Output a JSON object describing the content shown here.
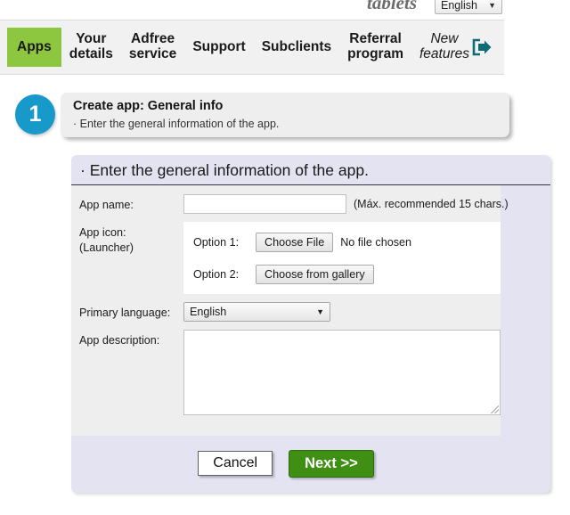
{
  "top": {
    "brand_tagline": "tablets",
    "language_selector": {
      "value": "English",
      "caret": "▼"
    }
  },
  "nav": {
    "items": [
      {
        "label": "Apps",
        "active": true,
        "italic": false
      },
      {
        "label": "Your\ndetails",
        "active": false,
        "italic": false
      },
      {
        "label": "Adfree\nservice",
        "active": false,
        "italic": false
      },
      {
        "label": "Support",
        "active": false,
        "italic": false
      },
      {
        "label": "Subclients",
        "active": false,
        "italic": false
      },
      {
        "label": "Referral\nprogram",
        "active": false,
        "italic": false
      },
      {
        "label": "New\nfeatures",
        "active": false,
        "italic": true
      }
    ],
    "logout_icon": "logout-arrow-icon"
  },
  "step": {
    "number": "1",
    "title": "Create app: General info",
    "subtitle": "· Enter the general information of the app."
  },
  "form": {
    "panel_title": "· Enter the general information of the app.",
    "app_name": {
      "label": "App name:",
      "value": "",
      "placeholder": "",
      "hint": "(Máx. recommended 15 chars.)"
    },
    "app_icon": {
      "label_line1": "App icon:",
      "label_line2": "(Launcher)",
      "option1_label": "Option 1:",
      "option1_button": "Choose File",
      "option1_status": "No file chosen",
      "option2_label": "Option 2:",
      "option2_button": "Choose from gallery"
    },
    "primary_language": {
      "label": "Primary language:",
      "value": "English",
      "caret": "▼"
    },
    "app_description": {
      "label": "App description:",
      "value": "",
      "placeholder": ""
    },
    "buttons": {
      "cancel": "Cancel",
      "next": "Next >>"
    }
  },
  "colors": {
    "nav_active_green": "#8dc63f",
    "step_badge_blue": "#1799ca",
    "next_button_green": "#3f8f14",
    "panel_lavender": "#e4e3f2",
    "form_body_gray": "#eeeeee"
  }
}
